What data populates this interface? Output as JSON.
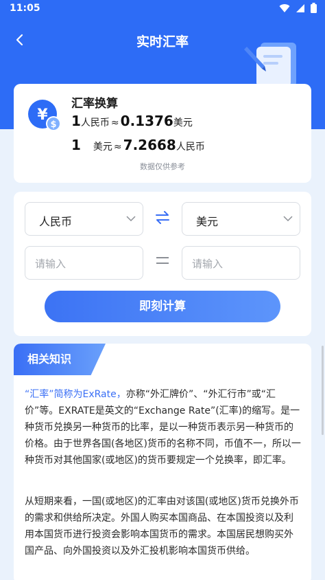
{
  "status": {
    "time": "11:05",
    "icons": [
      "wifi-icon",
      "signal-icon",
      "battery-icon"
    ]
  },
  "nav": {
    "title": "实时汇率"
  },
  "summary": {
    "title": "汇率换算",
    "line1": {
      "amount": "1",
      "from_unit": "人民币",
      "approx": "≈",
      "value": "0.1376",
      "to_unit": "美元"
    },
    "line2": {
      "amount": "1",
      "from_unit": "美元",
      "approx": "≈",
      "value": "7.2668",
      "to_unit": "人民币"
    },
    "note": "数据仅供参考"
  },
  "converter": {
    "from_currency": "人民币",
    "to_currency": "美元",
    "from_placeholder": "请输入",
    "to_placeholder": "请输入",
    "calc_label": "即刻计算"
  },
  "knowledge": {
    "tag": "相关知识",
    "para1_highlight": "“汇率”简称为ExRate，",
    "para1_rest": "亦称“外汇牌价”、“外汇行市”或“汇价”等。EXRATE是英文的“Exchange Rate”(汇率)的缩写。是一种货币兑换另一种货币的比率，是以一种货币表示另一种货币的价格。由于世界各国(各地区)货币的名称不同，币值不一，所以一种货币对其他国家(或地区)的货币要规定一个兑换率，即汇率。",
    "para2": "从短期来看，一国(或地区)的汇率由对该国(或地区)货币兑换外币的需求和供给所决定。外国人购买本国商品、在本国投资以及利用本国货币进行投资会影响本国货币的需求。本国居民想购买外国产品、向外国投资以及外汇投机影响本国货币供给。"
  },
  "colors": {
    "primary": "#2d6cf6",
    "background": "#eaf2fc",
    "highlight": "#3a6ff5"
  }
}
